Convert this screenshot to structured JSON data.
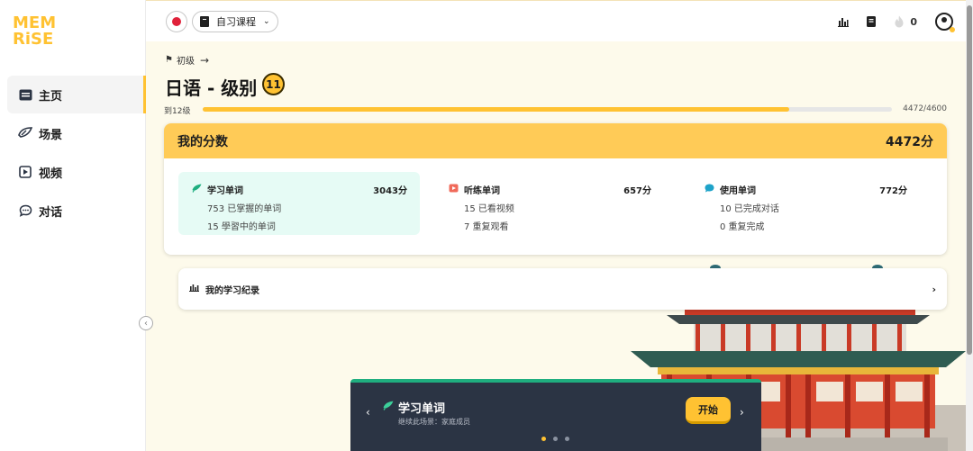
{
  "brand": {
    "logo_line1": "MEM",
    "logo_line2": "RiSE",
    "color": "#ffc232"
  },
  "sidebar": {
    "items": [
      {
        "label": "主页",
        "icon": "home-icon",
        "active": true
      },
      {
        "label": "场景",
        "icon": "scenarios-icon",
        "active": false
      },
      {
        "label": "视频",
        "icon": "video-icon",
        "active": false
      },
      {
        "label": "对话",
        "icon": "chat-icon",
        "active": false
      }
    ],
    "collapse_glyph": "‹"
  },
  "topbar": {
    "language_flag": "japan-flag-icon",
    "course_label": "自习课程",
    "streak_count": "0"
  },
  "main": {
    "breadcrumb": "初级",
    "title": "日语 - 级别",
    "level": "11",
    "progress": {
      "label": "到12级",
      "current": 4472,
      "total": 4600,
      "count_text": "4472/4600"
    },
    "score": {
      "heading": "我的分数",
      "total": "4472分",
      "columns": [
        {
          "title": "学习单词",
          "points": "3043分",
          "line1": "753 已掌握的单词",
          "line2": "15   學習中的单词",
          "icon": "learn-words-icon"
        },
        {
          "title": "听练单词",
          "points": "657分",
          "line1": "15 已看视频",
          "line2": "7    重复观看",
          "icon": "video-words-icon"
        },
        {
          "title": "使用单词",
          "points": "772分",
          "line1": "10 已完成对话",
          "line2": "0    重复完成",
          "icon": "chat-words-icon"
        }
      ]
    },
    "history_label": "我的学习纪录"
  },
  "lesson_card": {
    "title": "学习单词",
    "subtitle": "继续此场景：家庭成员",
    "start_label": "开始",
    "dots": 3,
    "active_dot": 0
  },
  "colors": {
    "accent": "#ffc232",
    "score_header": "#ffcb57",
    "learn_bg": "#e6fbf5",
    "card_dark": "#2b3444",
    "card_stripe": "#1fae7f"
  }
}
